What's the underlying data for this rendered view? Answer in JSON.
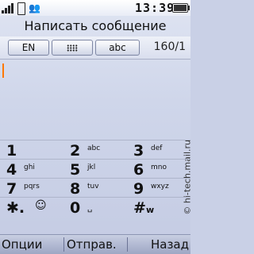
{
  "status": {
    "time": "13:39"
  },
  "title": "Написать сообщение",
  "mode": {
    "lang": "EN",
    "abc": "abc",
    "counter": "160/1"
  },
  "keys": [
    {
      "num": "1",
      "letters": ""
    },
    {
      "num": "2",
      "letters": "abc"
    },
    {
      "num": "3",
      "letters": "def"
    },
    {
      "num": "4",
      "letters": "ghi"
    },
    {
      "num": "5",
      "letters": "jkl"
    },
    {
      "num": "6",
      "letters": "mno"
    },
    {
      "num": "7",
      "letters": "pqrs"
    },
    {
      "num": "8",
      "letters": "tuv"
    },
    {
      "num": "9",
      "letters": "wxyz"
    },
    {
      "num": "✱.",
      "letters": "☺"
    },
    {
      "num": "0",
      "letters": "␣"
    },
    {
      "num": "#",
      "letters": "w"
    }
  ],
  "softkeys": {
    "left": "Опции",
    "middle": "Отправ.",
    "right": "Назад"
  },
  "watermark": "© hi-tech.mail.ru"
}
